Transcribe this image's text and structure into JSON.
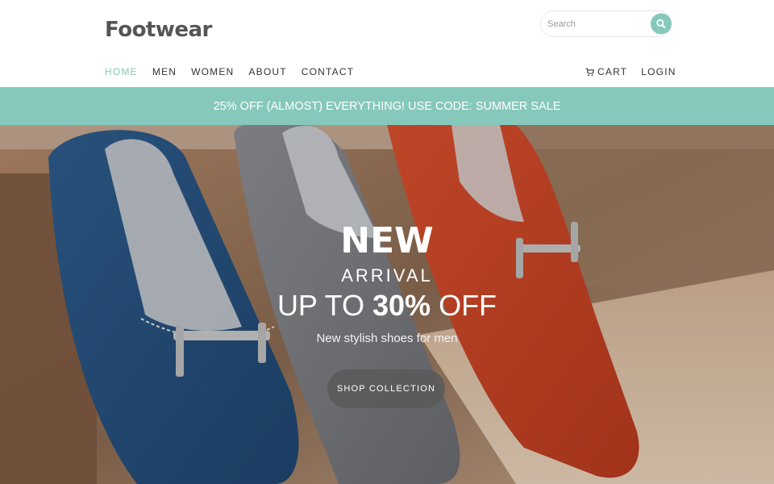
{
  "header": {
    "brand": "Footwear",
    "search_placeholder": "Search"
  },
  "nav": {
    "items": [
      {
        "label": "HOME",
        "active": true
      },
      {
        "label": "MEN",
        "active": false
      },
      {
        "label": "WOMEN",
        "active": false
      },
      {
        "label": "ABOUT",
        "active": false
      },
      {
        "label": "CONTACT",
        "active": false
      }
    ],
    "cart_label": "CART",
    "login_label": "LOGIN"
  },
  "promo": {
    "text": "25% OFF (ALMOST) EVERYTHING! USE CODE: SUMMER SALE"
  },
  "hero": {
    "headline": "NEW",
    "subheadline": "ARRIVAL",
    "offer_prefix": "UP TO ",
    "offer_value": "30%",
    "offer_suffix": " OFF",
    "tagline": "New stylish shoes for men",
    "cta_label": "SHOP COLLECTION",
    "image_subject": "three loafers: blue, grey, orange"
  },
  "colors": {
    "accent": "#86c8bc",
    "text_dark": "#333333",
    "brand_text": "#555555",
    "cta_bg": "#5a5a5a"
  },
  "icons": {
    "search": "search-icon",
    "cart": "cart-icon"
  }
}
